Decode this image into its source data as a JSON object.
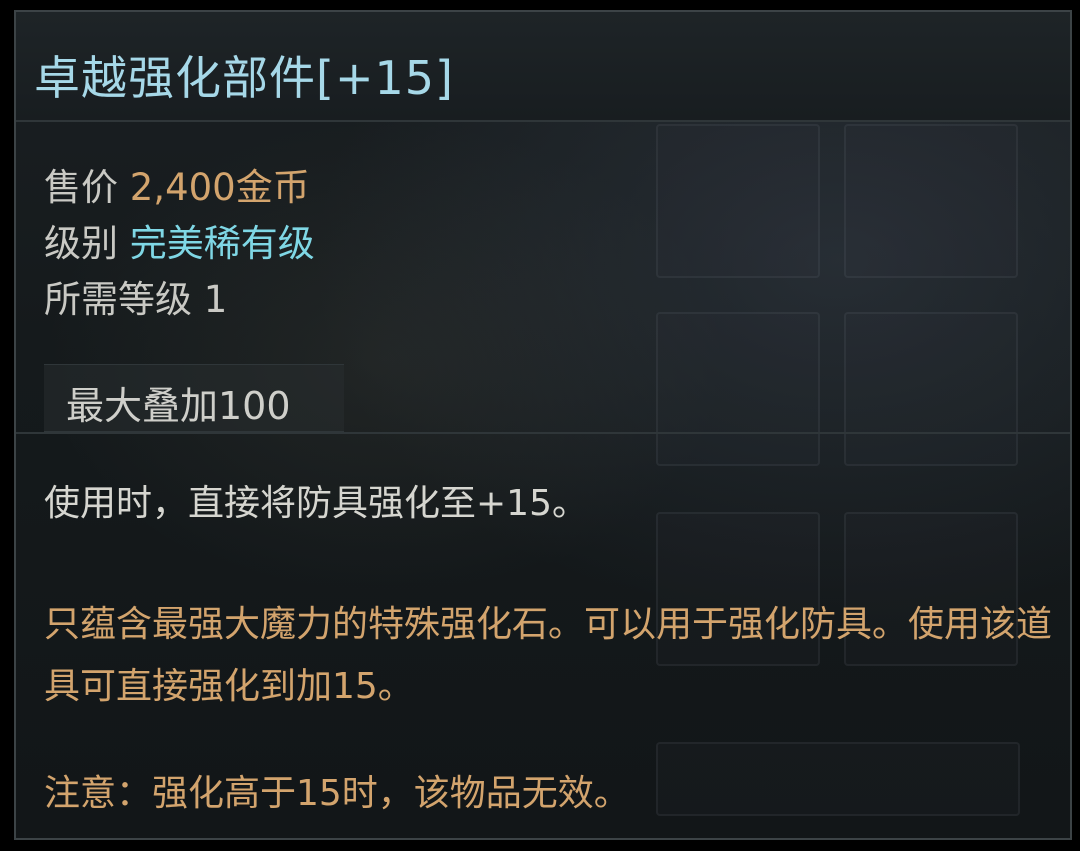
{
  "item": {
    "title": "卓越强化部件[+15]",
    "price_label": "售价",
    "price_value": "2,400金币",
    "grade_label": "级别",
    "grade_value": "完美稀有级",
    "level_label": "所需等级",
    "level_value": "1",
    "stack_text": "最大叠加100",
    "use_text": "使用时，直接将防具强化至+15。",
    "flavor_text": "只蕴含最强大魔力的特殊强化石。可以用于强化防具。使用该道具可直接强化到加15。",
    "note_text": "注意：强化高于15时，该物品无效。"
  },
  "colors": {
    "title": "#a6d8e8",
    "price": "#d3a46d",
    "grade": "#7fd7e5",
    "description": "#d3a46d",
    "label": "#c9c9c4"
  }
}
